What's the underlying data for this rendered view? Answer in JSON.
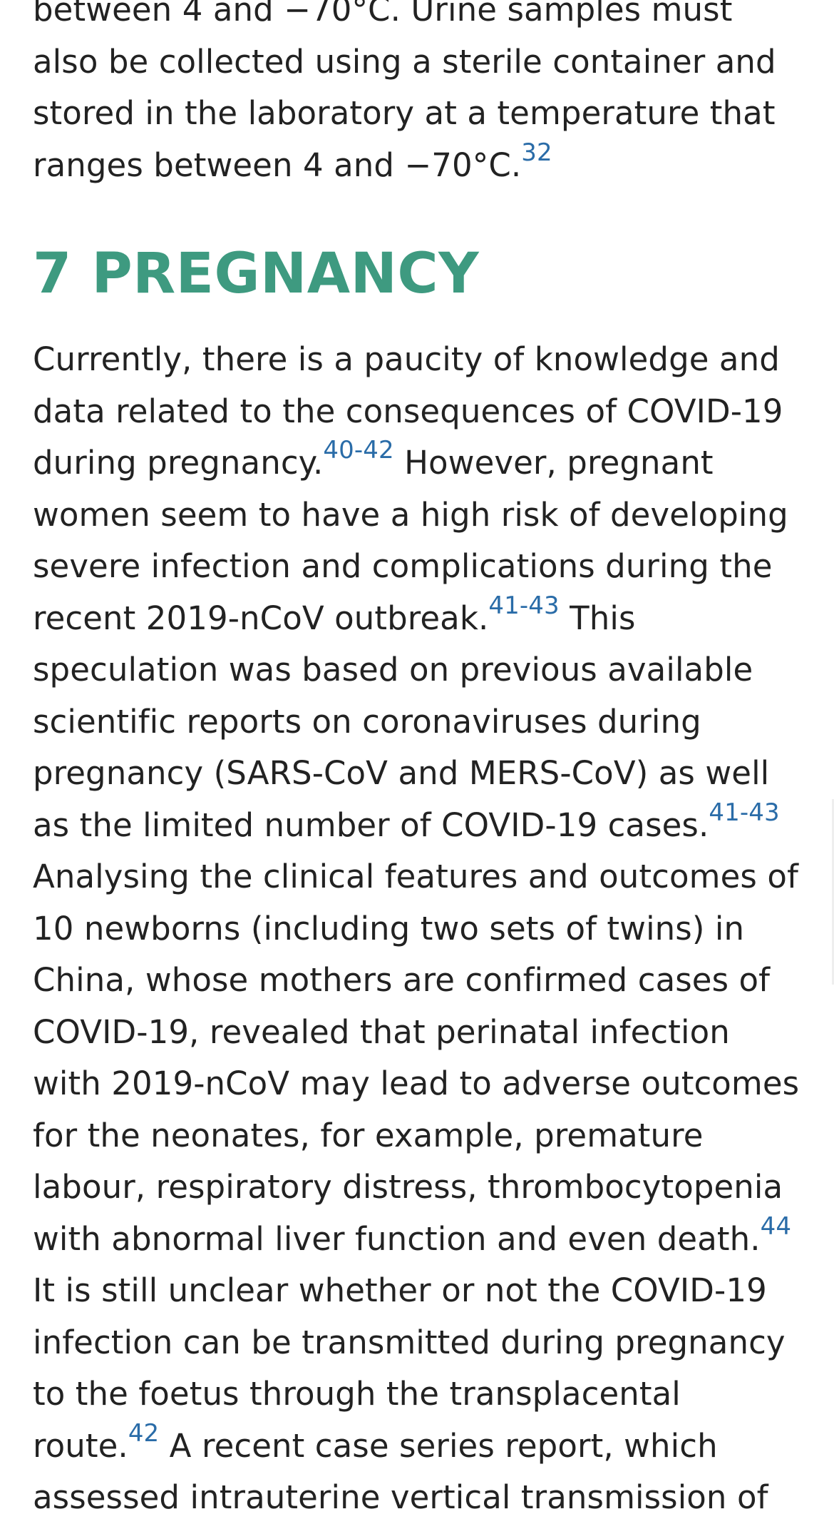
{
  "paragraph_prev": {
    "text": "between 4 and −70°C. Urine samples must also be collected using a sterile container and stored in the laboratory at a temperature that ranges between 4 and −70°C.",
    "refs": [
      "32"
    ]
  },
  "section": {
    "number": "7",
    "title": "PREGNANCY"
  },
  "paragraph_main": {
    "seg1": "Currently, there is a paucity of knowledge and data related to the consequences of COVID-19 during pregnancy.",
    "ref1_start": "40",
    "ref1_end": "42",
    "seg2": " However, pregnant women seem to have a high risk of developing severe infection and complications during the recent 2019-nCoV outbreak.",
    "ref2_start": "41",
    "ref2_end": "43",
    "seg3": " This speculation was based on previous available scientific reports on coronaviruses during pregnancy (SARS-CoV and MERS-CoV) as well as the limited number of COVID-19 cases.",
    "ref3_start": "41",
    "ref3_end": "43",
    "seg4": " Analysing the clinical features and outcomes of 10 newborns (including two sets of twins) in China, whose mothers are confirmed cases of COVID-19, revealed that perinatal infection with 2019-nCoV may lead to adverse outcomes for the neonates, for example, premature labour, respiratory distress, thrombocytopenia with abnormal liver function and even death.",
    "ref4": "44",
    "seg5": " It is still unclear whether or not the COVID-19 infection can be transmitted during pregnancy to the foetus through the transplacental route.",
    "ref5": "42",
    "seg6": " A recent case series report, which assessed intrauterine vertical transmission of",
    "ref_separator": "-"
  },
  "colors": {
    "heading": "#3e9a80",
    "reference_link": "#2a6ca8",
    "body_text": "#222222"
  }
}
